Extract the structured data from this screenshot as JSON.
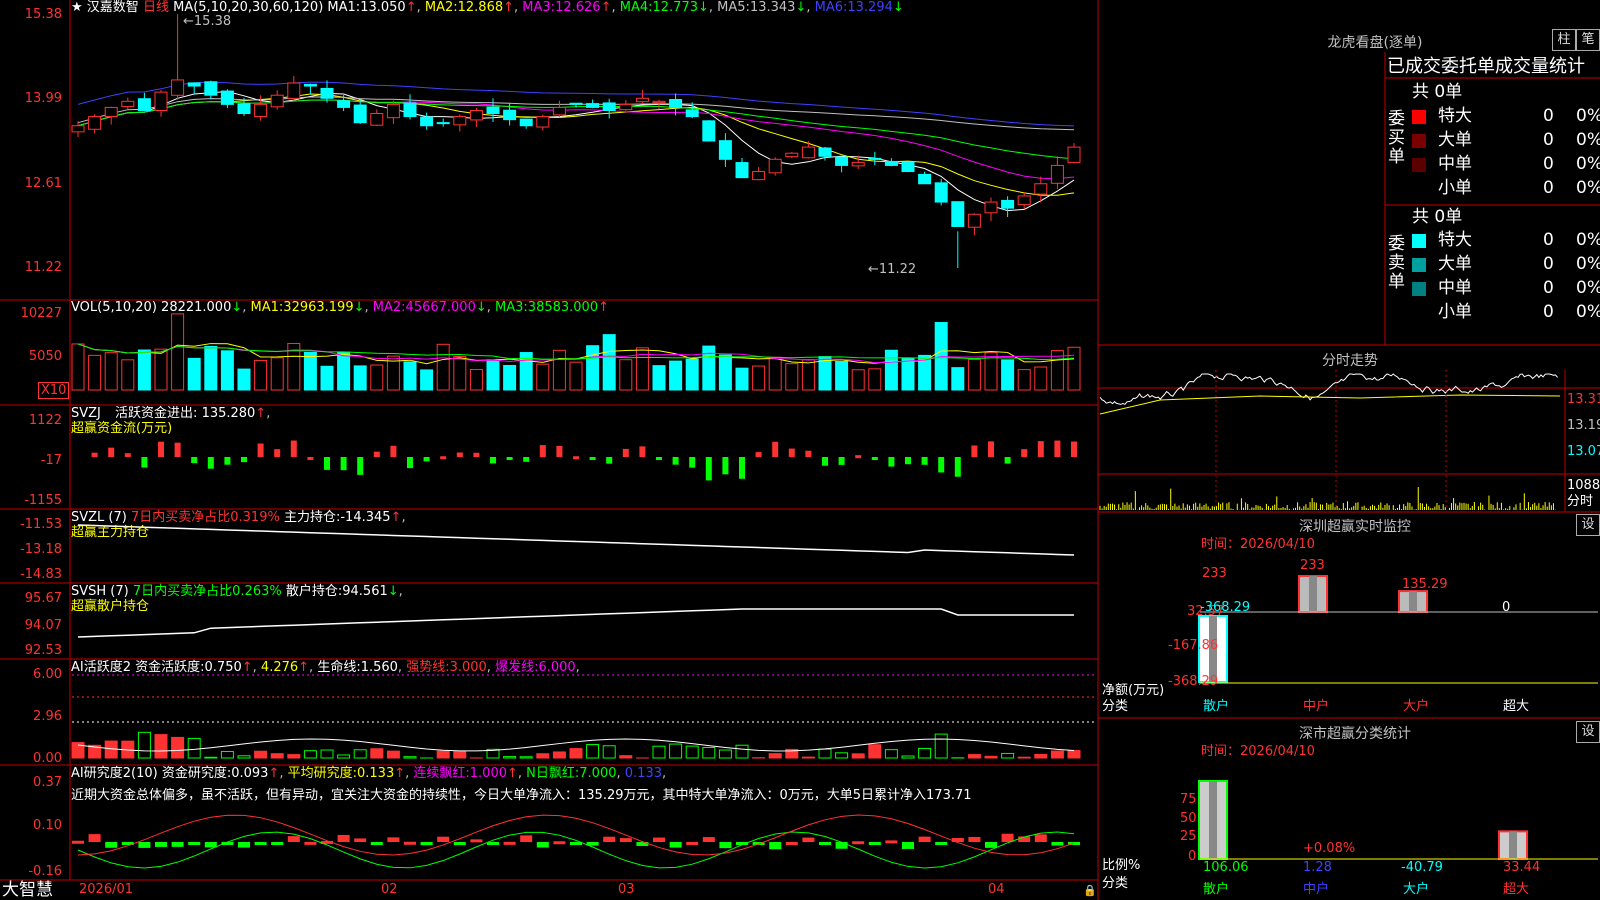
{
  "colors": {
    "up": "#ff3232",
    "down": "#00ffff",
    "ma1": "#ffffff",
    "ma2": "#ffff00",
    "ma3": "#ff00ff",
    "ma4": "#00ff00",
    "ma5": "#c0c0c0",
    "ma6": "#4040ff",
    "grid": "#c00000"
  },
  "main": {
    "star": "★",
    "stock_name": "汉嘉数智",
    "period": "日线",
    "ma_header": "MA(5,10,20,30,60,120)",
    "ma": [
      {
        "label": "MA1:",
        "value": "13.050",
        "arrow": "↑"
      },
      {
        "label": "MA2:",
        "value": "12.868",
        "arrow": "↑"
      },
      {
        "label": "MA3:",
        "value": "12.626",
        "arrow": "↑"
      },
      {
        "label": "MA4:",
        "value": "12.773",
        "arrow": "↓"
      },
      {
        "label": "MA5:",
        "value": "13.343",
        "arrow": "↓"
      },
      {
        "label": "MA6:",
        "value": "13.294",
        "arrow": "↓"
      }
    ],
    "high_mark": "15.38",
    "low_mark": "11.22",
    "y_ticks": [
      "15.38",
      "13.99",
      "12.61",
      "11.22"
    ]
  },
  "vol": {
    "header": "VOL(5,10,20)",
    "value": "28221.000",
    "value_arrow": "↓",
    "ma": [
      {
        "label": "MA1:",
        "value": "32963.199",
        "arrow": "↓"
      },
      {
        "label": "MA2:",
        "value": "45667.000",
        "arrow": "↓"
      },
      {
        "label": "MA3:",
        "value": "38583.000",
        "arrow": "↑"
      }
    ],
    "y_ticks": [
      "10227",
      "5050"
    ],
    "unit": "X10"
  },
  "svzj": {
    "header": "SVZJ",
    "label": "活跃资金进出:",
    "value": "135.280",
    "arrow": "↑",
    "subtitle": "超赢资金流(万元)",
    "y_ticks": [
      "1122",
      "-17",
      "-1155"
    ]
  },
  "svzl": {
    "header": "SVZL (7)",
    "ratio": "7日内买卖净占比0.319%",
    "label": "主力持仓:",
    "value": "-14.345",
    "arrow": "↑",
    "subtitle": "超赢主力持仓",
    "y_ticks": [
      "-11.53",
      "-13.18",
      "-14.83"
    ]
  },
  "svsh": {
    "header": "SVSH (7)",
    "ratio": "7日内买卖净占比0.263%",
    "label": "散户持仓:",
    "value": "94.561",
    "arrow": "↓",
    "subtitle": "超赢散户持仓",
    "y_ticks": [
      "95.67",
      "94.07",
      "92.53"
    ]
  },
  "ai1": {
    "header": "AI活跃度2",
    "label": "资金活跃度:",
    "value": "0.750",
    "v2": "4.276",
    "life_label": "生命线:",
    "life": "1.560",
    "strong_label": "强势线:",
    "strong": "3.000",
    "burst_label": "爆发线:",
    "burst": "6.000",
    "y_ticks": [
      "6.00",
      "2.96",
      "0.00"
    ]
  },
  "ai2": {
    "header": "AI研究度2(10)",
    "label": "资金研究度:",
    "value": "0.093",
    "avg_label": "平均研究度:",
    "avg": "0.133",
    "cont_label": "连续飘红:",
    "cont": "1.000",
    "n_label": "N日飘红:",
    "n": "7.000",
    "n2": "0.133",
    "comment": "近期大资金总体偏多，虽不活跃，但有异动，宜关注大资金的持续性，今日大单净流入：135.29万元，其中特大单净流入：0万元，大单5日累计净入173.71",
    "y_ticks": [
      "0.37",
      "0.10",
      "-0.16"
    ]
  },
  "xaxis": {
    "labels": [
      "2026/01",
      "02",
      "03",
      "04"
    ]
  },
  "footer": {
    "brand": "大智慧"
  },
  "right": {
    "longhu": {
      "title": "龙虎看盘(逐单)",
      "btn1": "柱",
      "btn2": "笔",
      "stats_title": "已成交委托单成交量统计",
      "buy": {
        "side": "委买单",
        "total": "共 0单",
        "rows": [
          {
            "name": "特大",
            "count": "0",
            "pct": "0%"
          },
          {
            "name": "大单",
            "count": "0",
            "pct": "0%"
          },
          {
            "name": "中单",
            "count": "0",
            "pct": "0%"
          },
          {
            "name": "小单",
            "count": "0",
            "pct": "0%"
          }
        ]
      },
      "sell": {
        "side": "委卖单",
        "total": "共 0单",
        "rows": [
          {
            "name": "特大",
            "count": "0",
            "pct": "0%"
          },
          {
            "name": "大单",
            "count": "0",
            "pct": "0%"
          },
          {
            "name": "中单",
            "count": "0",
            "pct": "0%"
          },
          {
            "name": "小单",
            "count": "0",
            "pct": "0%"
          }
        ]
      }
    },
    "intraday": {
      "title": "分时走势",
      "y_ticks": [
        "13.31",
        "13.19",
        "13.07"
      ],
      "vol_tick": "1088",
      "vol_unit": "分时"
    },
    "monitor": {
      "title": "深圳超赢实时监控",
      "btn": "设",
      "time_label": "时间：2026/04/10",
      "y_ticks": [
        "233",
        "32.57",
        "-167.86",
        "-368.29"
      ],
      "ylabel": "净额(万元)",
      "xlabel": "分类",
      "cats": [
        "散户",
        "中户",
        "大户",
        "超大"
      ],
      "values": [
        -368.29,
        233,
        135.29,
        0
      ],
      "value_labels": [
        "-368.29",
        "233",
        "135.29",
        "0"
      ]
    },
    "classify": {
      "title": "深市超赢分类统计",
      "btn": "设",
      "time_label": "时间：2026/04/10",
      "y_ticks": [
        "75",
        "50",
        "25",
        "0"
      ],
      "ylabel": "比例%",
      "xlabel": "分类",
      "cats": [
        "散户",
        "中户",
        "大户",
        "超大"
      ],
      "values": [
        106.06,
        1.28,
        -40.79,
        33.44
      ],
      "value_labels": [
        "106.06",
        "1.28",
        "-40.79",
        "33.44"
      ],
      "note": "+0.08%"
    }
  }
}
